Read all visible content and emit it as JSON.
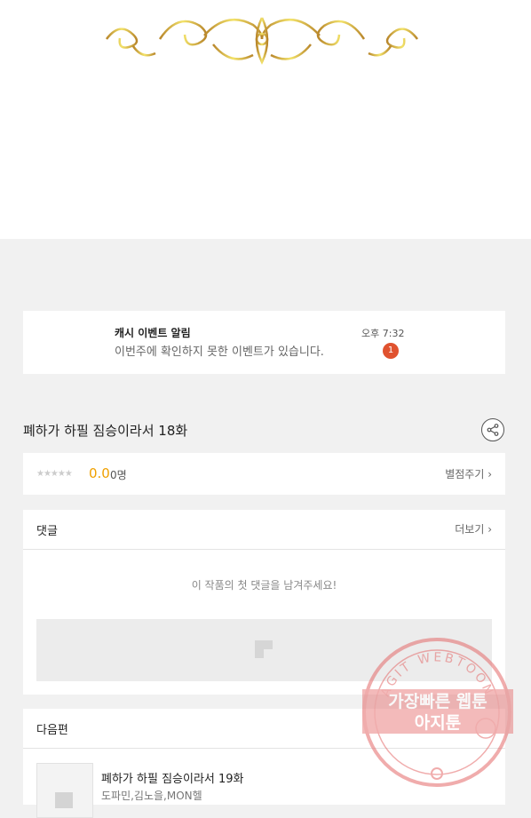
{
  "notification": {
    "title": "캐시 이벤트 알림",
    "message": "이번주에 확인하지 못한 이벤트가 있습니다.",
    "time": "오후 7:32",
    "badge": "1"
  },
  "episode": {
    "title": "폐하가 하필 짐승이라서 18화"
  },
  "rating": {
    "stars": "★★★★★",
    "score": "0.0",
    "votes": "0명",
    "rate_label": "별점주기 ›"
  },
  "comments": {
    "header": "댓글",
    "more_label": "더보기 ›",
    "empty_message": "이 작품의 첫 댓글을 남겨주세요!"
  },
  "next_episode": {
    "header": "다음편",
    "title": "폐하가 하필 짐승이라서 19화",
    "authors": "도파민,김노을,MON헬"
  },
  "watermark": {
    "arc_text": "AGIT WEBTOON",
    "line1": "가장빠른 웹툰",
    "line2": "아지툰"
  },
  "colors": {
    "accent_score": "#f0a000",
    "badge": "#e0522f",
    "stamp": "#e46a6a",
    "ornament_gold": "#c9a23a"
  }
}
